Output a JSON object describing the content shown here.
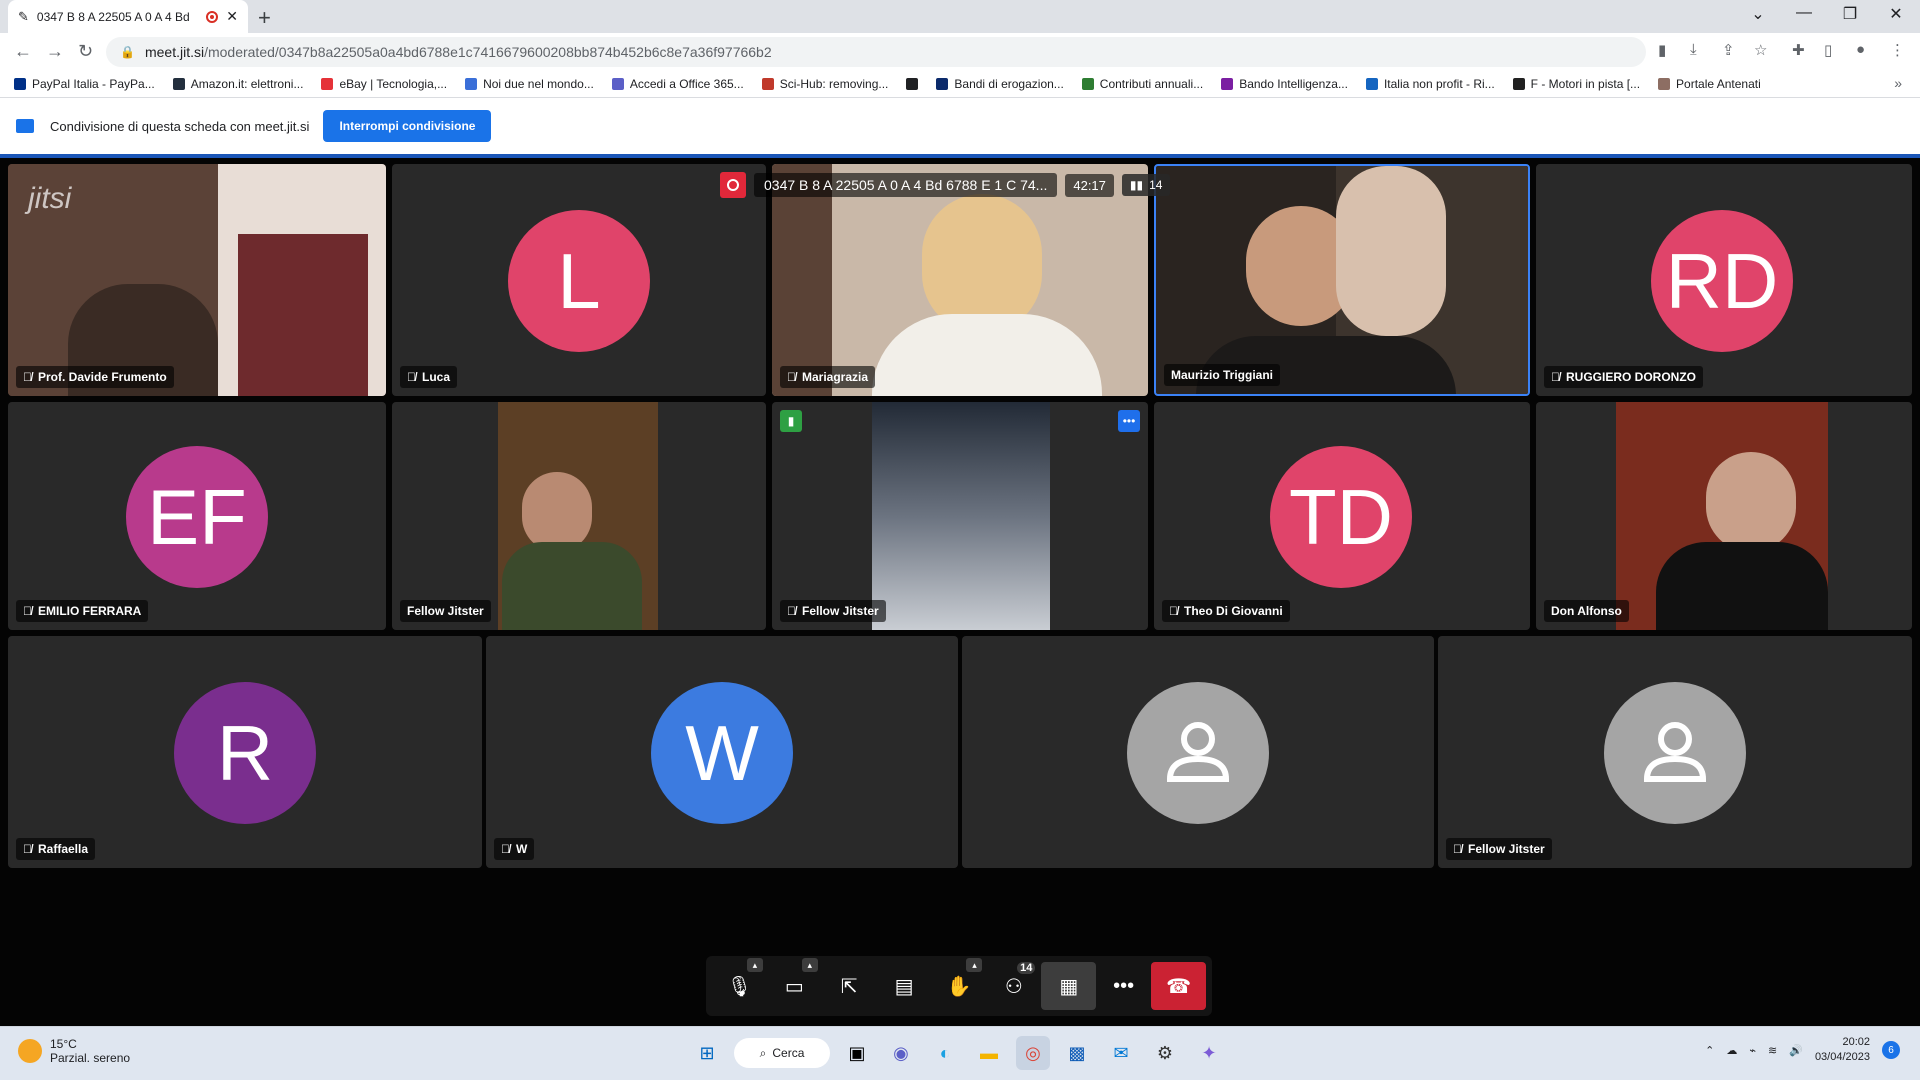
{
  "browser": {
    "tab_title": "0347 B 8 A 22505 A 0 A 4 Bd",
    "url_host": "meet.jit.si",
    "url_path": "/moderated/0347b8a22505a0a4bd6788e1c7416679600208bb874b452b6c8e7a36f97766b2",
    "bookmarks": [
      {
        "label": "PayPal Italia - PayPa...",
        "color": "#003087"
      },
      {
        "label": "Amazon.it: elettroni...",
        "color": "#232f3e"
      },
      {
        "label": "eBay | Tecnologia,...",
        "color": "#e53238"
      },
      {
        "label": "Noi due nel mondo...",
        "color": "#3a6fd8"
      },
      {
        "label": "Accedi a Office 365...",
        "color": "#5b5fc7"
      },
      {
        "label": "Sci-Hub: removing...",
        "color": "#c0392b"
      },
      {
        "label": "",
        "color": "#202124"
      },
      {
        "label": "Bandi di erogazion...",
        "color": "#0b2a6b"
      },
      {
        "label": "Contributi annuali...",
        "color": "#2e7d32"
      },
      {
        "label": "Bando Intelligenza...",
        "color": "#7b1fa2"
      },
      {
        "label": "Italia non profit - Ri...",
        "color": "#1565c0"
      },
      {
        "label": "F - Motori in pista [...",
        "color": "#212121"
      },
      {
        "label": "Portale Antenati",
        "color": "#8d6e63"
      }
    ]
  },
  "sharebar": {
    "text": "Condivisione di questa scheda con meet.jit.si",
    "button": "Interrompi condivisione"
  },
  "meeting": {
    "title": "0347 B 8 A 22505 A 0 A 4 Bd 6788 E 1 C 74...",
    "timer": "42:17",
    "participant_count": "14",
    "brand": "jitsi",
    "participants": [
      {
        "name": "Prof. Davide Frumento",
        "muted": true
      },
      {
        "name": "Luca",
        "initials": "L",
        "muted": true
      },
      {
        "name": "Mariagrazia",
        "muted": true
      },
      {
        "name": "Maurizio Triggiani",
        "muted": false
      },
      {
        "name": "RUGGIERO DORONZO",
        "initials": "RD",
        "muted": true
      },
      {
        "name": "EMILIO FERRARA",
        "initials": "EF",
        "muted": true
      },
      {
        "name": "Fellow Jitster",
        "muted": false
      },
      {
        "name": "Fellow Jitster",
        "muted": true
      },
      {
        "name": "Theo Di Giovanni",
        "initials": "TD",
        "muted": true
      },
      {
        "name": "Don Alfonso",
        "muted": false
      },
      {
        "name": "Raffaella",
        "initials": "R",
        "muted": true
      },
      {
        "name": "W",
        "initials": "W",
        "muted": true
      },
      {
        "name": "",
        "muted": false
      },
      {
        "name": "Fellow Jitster",
        "muted": true
      }
    ],
    "toolbox_badge": "14"
  },
  "taskbar": {
    "temperature": "15°C",
    "weather": "Parzial. sereno",
    "search_label": "Cerca",
    "time": "20:02",
    "date": "03/04/2023",
    "notifications": "6"
  }
}
